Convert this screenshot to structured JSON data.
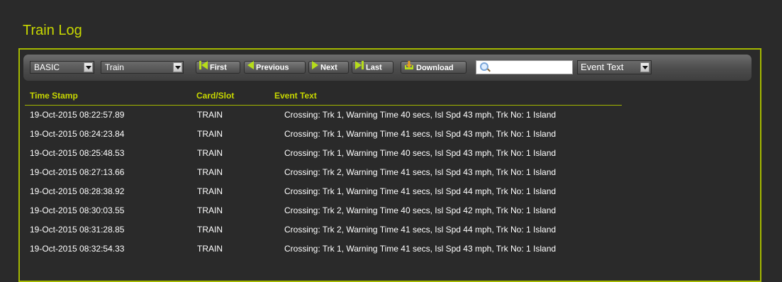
{
  "page": {
    "title": "Train Log"
  },
  "toolbar": {
    "select1": "BASIC",
    "select2": "Train",
    "buttons": {
      "first": "First",
      "previous": "Previous",
      "next": "Next",
      "last": "Last",
      "download": "Download"
    },
    "search_value": "",
    "filter": "Event Text"
  },
  "table": {
    "columns": [
      "Time Stamp",
      "Card/Slot",
      "Event Text"
    ],
    "rows": [
      [
        "19-Oct-2015 08:22:57.89",
        "TRAIN",
        "Crossing: Trk 1, Warning Time 40 secs, Isl Spd 43 mph, Trk No: 1 Island"
      ],
      [
        "19-Oct-2015 08:24:23.84",
        "TRAIN",
        "Crossing: Trk 1, Warning Time 41 secs, Isl Spd 43 mph, Trk No: 1 Island"
      ],
      [
        "19-Oct-2015 08:25:48.53",
        "TRAIN",
        "Crossing: Trk 1, Warning Time 40 secs, Isl Spd 43 mph, Trk No: 1 Island"
      ],
      [
        "19-Oct-2015 08:27:13.66",
        "TRAIN",
        "Crossing: Trk 2, Warning Time 41 secs, Isl Spd 43 mph, Trk No: 1 Island"
      ],
      [
        "19-Oct-2015 08:28:38.92",
        "TRAIN",
        "Crossing: Trk 1, Warning Time 41 secs, Isl Spd 44 mph, Trk No: 1 Island"
      ],
      [
        "19-Oct-2015 08:30:03.55",
        "TRAIN",
        "Crossing: Trk 2, Warning Time 40 secs, Isl Spd 42 mph, Trk No: 1 Island"
      ],
      [
        "19-Oct-2015 08:31:28.85",
        "TRAIN",
        "Crossing: Trk 2, Warning Time 41 secs, Isl Spd 44 mph, Trk No: 1 Island"
      ],
      [
        "19-Oct-2015 08:32:54.33",
        "TRAIN",
        "Crossing: Trk 1, Warning Time 41 secs, Isl Spd 43 mph, Trk No: 1 Island"
      ]
    ]
  },
  "colors": {
    "accent": "#c8d800",
    "background": "#2a2a2a",
    "icon_green": "#b6dd1a"
  },
  "icons": [
    "first-icon",
    "previous-icon",
    "next-icon",
    "last-icon",
    "download-icon",
    "search-icon",
    "chevron-down-icon"
  ]
}
